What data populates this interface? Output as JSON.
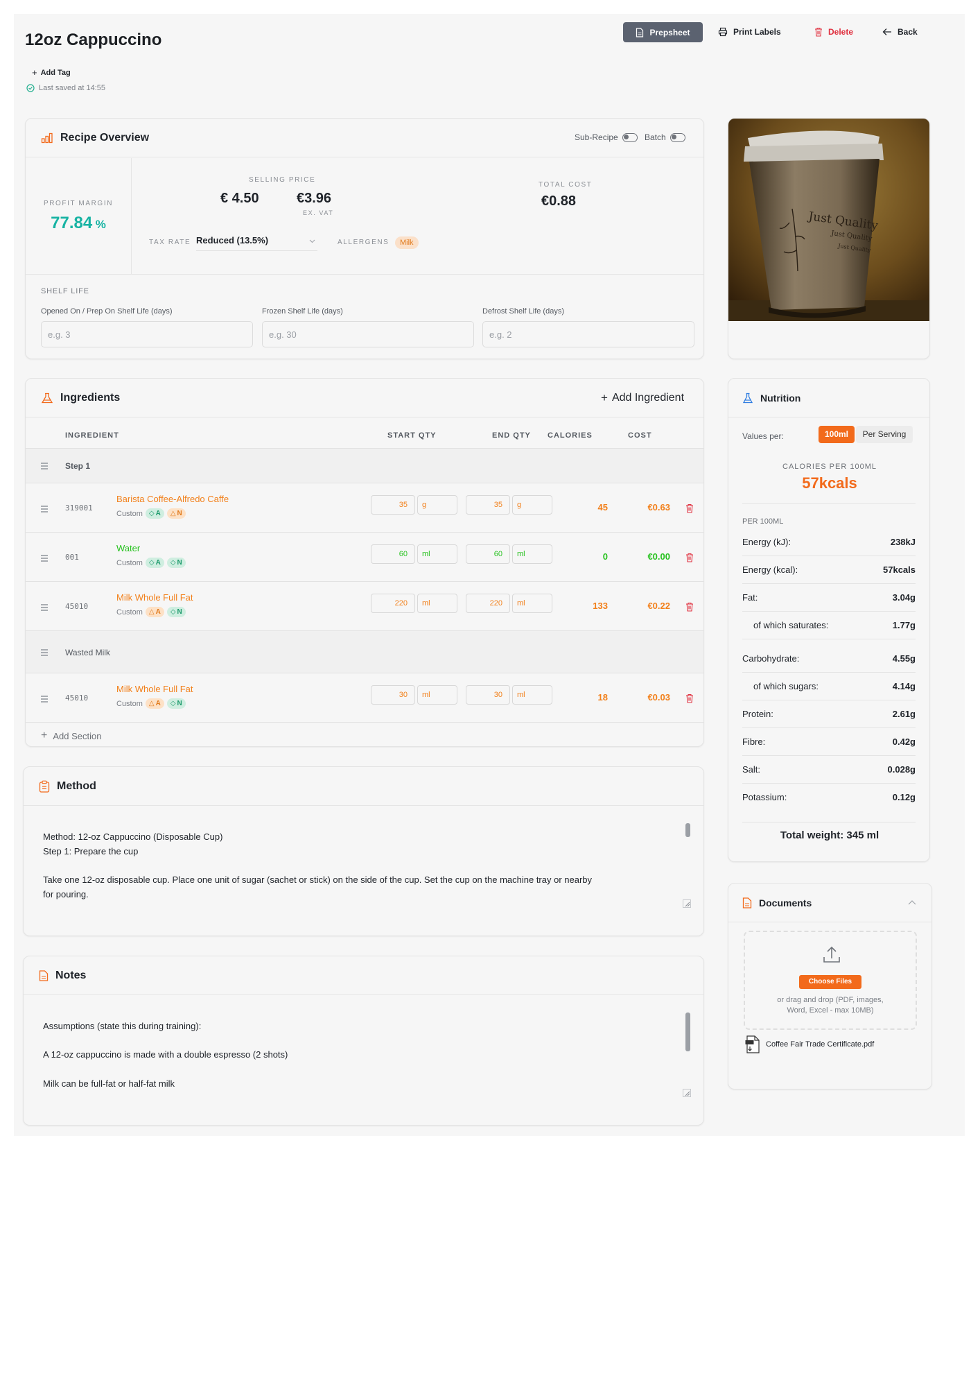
{
  "header": {
    "title": "12oz Cappuccino",
    "add_tag": "Add Tag",
    "last_saved": "Last saved at 14:55",
    "buttons": {
      "prepsheet": "Prepsheet",
      "print_labels": "Print Labels",
      "delete": "Delete",
      "back": "Back"
    }
  },
  "overview": {
    "title": "Recipe Overview",
    "sub_recipe_label": "Sub-Recipe",
    "batch_label": "Batch",
    "profit_margin_label": "PROFIT MARGIN",
    "profit_margin_value": "77.84",
    "profit_margin_unit": "%",
    "selling_price_label": "SELLING PRICE",
    "price_inc_vat": "€ 4.50",
    "price_ex_vat": "€3.96",
    "ex_vat_label": "EX. VAT",
    "total_cost_label": "TOTAL COST",
    "total_cost": "€0.88",
    "tax_rate_label": "TAX RATE",
    "tax_rate_value": "Reduced (13.5%)",
    "allergens_label": "ALLERGENS",
    "allergen_badge": "Milk",
    "shelf_life_label": "SHELF LIFE",
    "shelf_fields": [
      {
        "label": "Opened On / Prep On Shelf Life (days)",
        "placeholder": "e.g. 3"
      },
      {
        "label": "Frozen Shelf Life (days)",
        "placeholder": "e.g. 30"
      },
      {
        "label": "Defrost Shelf Life (days)",
        "placeholder": "e.g. 2"
      }
    ]
  },
  "ingredients": {
    "title": "Ingredients",
    "add_label": "Add Ingredient",
    "columns": {
      "ingredient": "INGREDIENT",
      "start_qty": "START QTY",
      "end_qty": "END QTY",
      "calories": "CALORIES",
      "cost": "COST"
    },
    "sections": [
      {
        "name": "Step 1",
        "rows": [
          {
            "code": "319001",
            "name": "Barista Coffee-Alfredo Caffe",
            "type": "Custom",
            "badges": [
              "A",
              "N"
            ],
            "badge_tones": [
              "g",
              "o"
            ],
            "start": "35",
            "start_unit": "g",
            "end": "35",
            "end_unit": "g",
            "calories": "45",
            "cost": "€0.63",
            "tone": "orange"
          },
          {
            "code": "001",
            "name": "Water",
            "type": "Custom",
            "badges": [
              "A",
              "N"
            ],
            "badge_tones": [
              "g",
              "g"
            ],
            "start": "60",
            "start_unit": "ml",
            "end": "60",
            "end_unit": "ml",
            "calories": "0",
            "cost": "€0.00",
            "tone": "green"
          },
          {
            "code": "45010",
            "name": "Milk Whole Full Fat",
            "type": "Custom",
            "badges": [
              "A",
              "N"
            ],
            "badge_tones": [
              "o",
              "g"
            ],
            "start": "220",
            "start_unit": "ml",
            "end": "220",
            "end_unit": "ml",
            "calories": "133",
            "cost": "€0.22",
            "tone": "orange"
          }
        ]
      },
      {
        "name": "Wasted Milk",
        "rows": [
          {
            "code": "45010",
            "name": "Milk Whole Full Fat",
            "type": "Custom",
            "badges": [
              "A",
              "N"
            ],
            "badge_tones": [
              "o",
              "g"
            ],
            "start": "30",
            "start_unit": "ml",
            "end": "30",
            "end_unit": "ml",
            "calories": "18",
            "cost": "€0.03",
            "tone": "orange"
          }
        ]
      }
    ],
    "add_section": "Add Section"
  },
  "method": {
    "title": "Method",
    "lines": [
      "Method: 12-oz Cappuccino (Disposable Cup)",
      "Step 1: Prepare the cup",
      "",
      "Take one 12-oz disposable cup. Place one unit of sugar (sachet or stick) on the side of the cup. Set the cup on the machine tray or nearby",
      "for pouring."
    ]
  },
  "notes": {
    "title": "Notes",
    "lines": [
      "Assumptions (state this during training):",
      "",
      "A 12-oz cappuccino is made with a double espresso (2 shots)",
      "",
      "Milk can be full-fat or half-fat milk"
    ]
  },
  "nutrition": {
    "title": "Nutrition",
    "values_per_label": "Values per:",
    "per_100ml": "100ml",
    "per_serving": "Per Serving",
    "calories_label": "CALORIES PER 100ML",
    "calories_value": "57kcals",
    "per_label": "PER 100ML",
    "rows": [
      {
        "label": "Energy (kJ):",
        "value": "238kJ"
      },
      {
        "label": "Energy (kcal):",
        "value": "57kcals"
      },
      {
        "label": "Fat:",
        "value": "3.04g"
      },
      {
        "label": "of which saturates:",
        "value": "1.77g"
      },
      {
        "label": "Carbohydrate:",
        "value": "4.55g"
      },
      {
        "label": "of which sugars:",
        "value": "4.14g"
      },
      {
        "label": "Protein:",
        "value": "2.61g"
      },
      {
        "label": "Fibre:",
        "value": "0.42g"
      },
      {
        "label": "Salt:",
        "value": "0.028g"
      },
      {
        "label": "Potassium:",
        "value": "0.12g"
      }
    ],
    "total_weight": "Total weight: 345 ml"
  },
  "documents": {
    "title": "Documents",
    "choose_files": "Choose Files",
    "drop_hint_1": "or drag and drop (PDF, images,",
    "drop_hint_2": "Word, Excel - max 10MB)",
    "file_name": "Coffee Fair Trade Certificate.pdf"
  },
  "colors": {
    "accent": "#f26a1b",
    "teal": "#17b3a3",
    "green": "#27c21f",
    "red": "#e0303f",
    "dark_button": "#5b6270"
  },
  "photo": {
    "cup_text_1": "Just Quality",
    "cup_text_2": "Just Quality",
    "cup_text_3": "Just Quality"
  }
}
